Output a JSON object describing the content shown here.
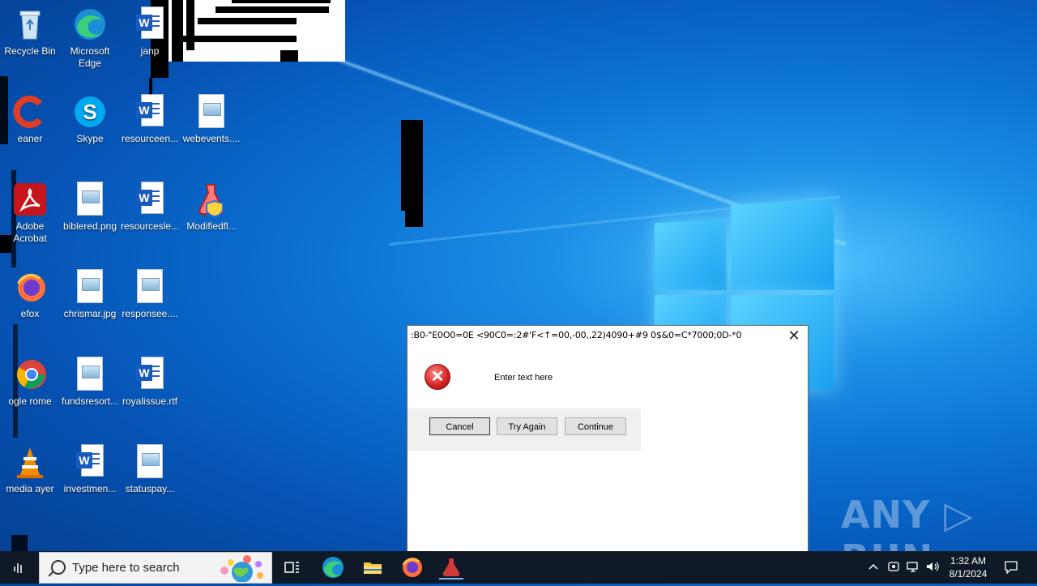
{
  "desktop": {
    "icons": [
      {
        "label": "Recycle Bin"
      },
      {
        "label": "Microsoft Edge"
      },
      {
        "label": "janp"
      },
      {
        "label": "eaner"
      },
      {
        "label": "Skype"
      },
      {
        "label": "resourceen..."
      },
      {
        "label": "webevents...."
      },
      {
        "label": "Adobe Acrobat"
      },
      {
        "label": "biblered.png"
      },
      {
        "label": "resourcesle..."
      },
      {
        "label": "Modifiedfl..."
      },
      {
        "label": "efox"
      },
      {
        "label": "chrismar.jpg"
      },
      {
        "label": "responsee...."
      },
      {
        "label": "ogle rome"
      },
      {
        "label": "fundsresort..."
      },
      {
        "label": "royalissue.rtf"
      },
      {
        "label": "media ayer"
      },
      {
        "label": "investmen..."
      },
      {
        "label": "statuspay..."
      }
    ]
  },
  "dialog": {
    "title": ":B0-\"E0O0=0E  <90C0=:2#'F<↑=00,-00,,22)4090+#9 0$&0=C*7000;0D-*0",
    "message": "Enter text here",
    "buttons": {
      "cancel": "Cancel",
      "try_again": "Try Again",
      "continue": "Continue"
    },
    "close_glyph": "✕"
  },
  "taskbar": {
    "search_placeholder": "Type here to search",
    "time": "1:32 AM",
    "date": "8/1/2024"
  },
  "watermark": "ANY ▷ RUN"
}
